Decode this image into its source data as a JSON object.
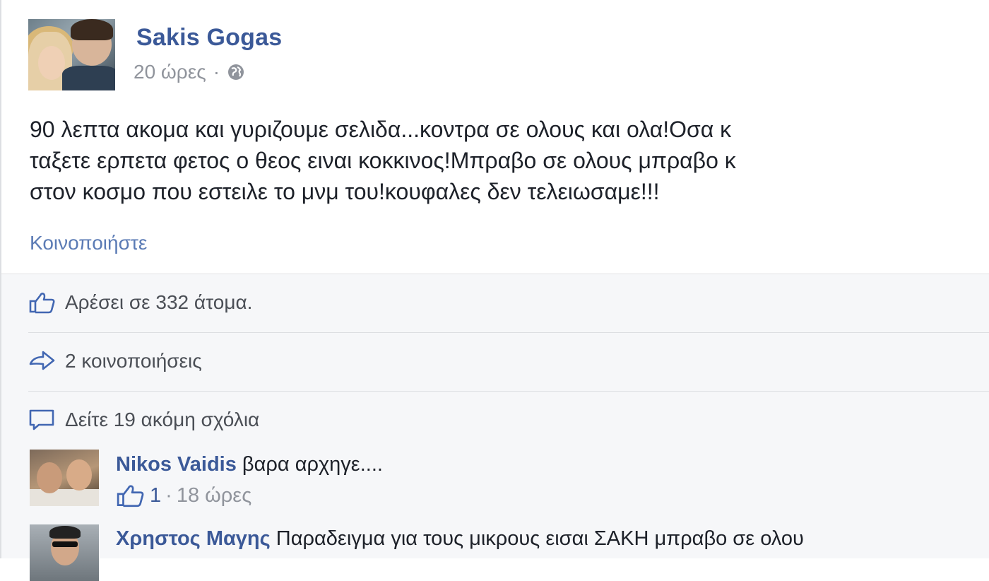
{
  "post": {
    "author": "Sakis Gogas",
    "time": "20 ώρες",
    "separator": "·",
    "privacy_icon": "globe-icon",
    "text_lines": [
      "90 λεπτα ακομα και γυριζουμε σελιδα...κοντρα σε ολους και ολα!Οσα κ",
      "ταξετε ερπετα φετος ο θεος ειναι κοκκινος!Μπραβο σε ολους μπραβο κ",
      "στον κοσμο που εστειλε το μνμ του!κουφαλες δεν τελειωσαμε!!!"
    ],
    "share_link": "Κοινοποιήστε"
  },
  "ufi": {
    "likes": "Αρέσει σε 332 άτομα.",
    "shares": "2 κοινοποιήσεις",
    "more_comments": "Δείτε 19 ακόμη σχόλια"
  },
  "comments": [
    {
      "author": "Nikos Vaidis",
      "text": "βαρα αρχηγε....",
      "likes": "1",
      "separator": "·",
      "time": "18 ώρες"
    },
    {
      "author": "Χρηστος Μαγης",
      "text": "Παραδειγμα για τους μικρους εισαι ΣΑΚΗ μπραβο σε ολου"
    }
  ],
  "colors": {
    "link": "#3b5998",
    "secondary_text": "#90949c",
    "body_text": "#1d2129",
    "ufi_background": "#f6f7f9"
  }
}
